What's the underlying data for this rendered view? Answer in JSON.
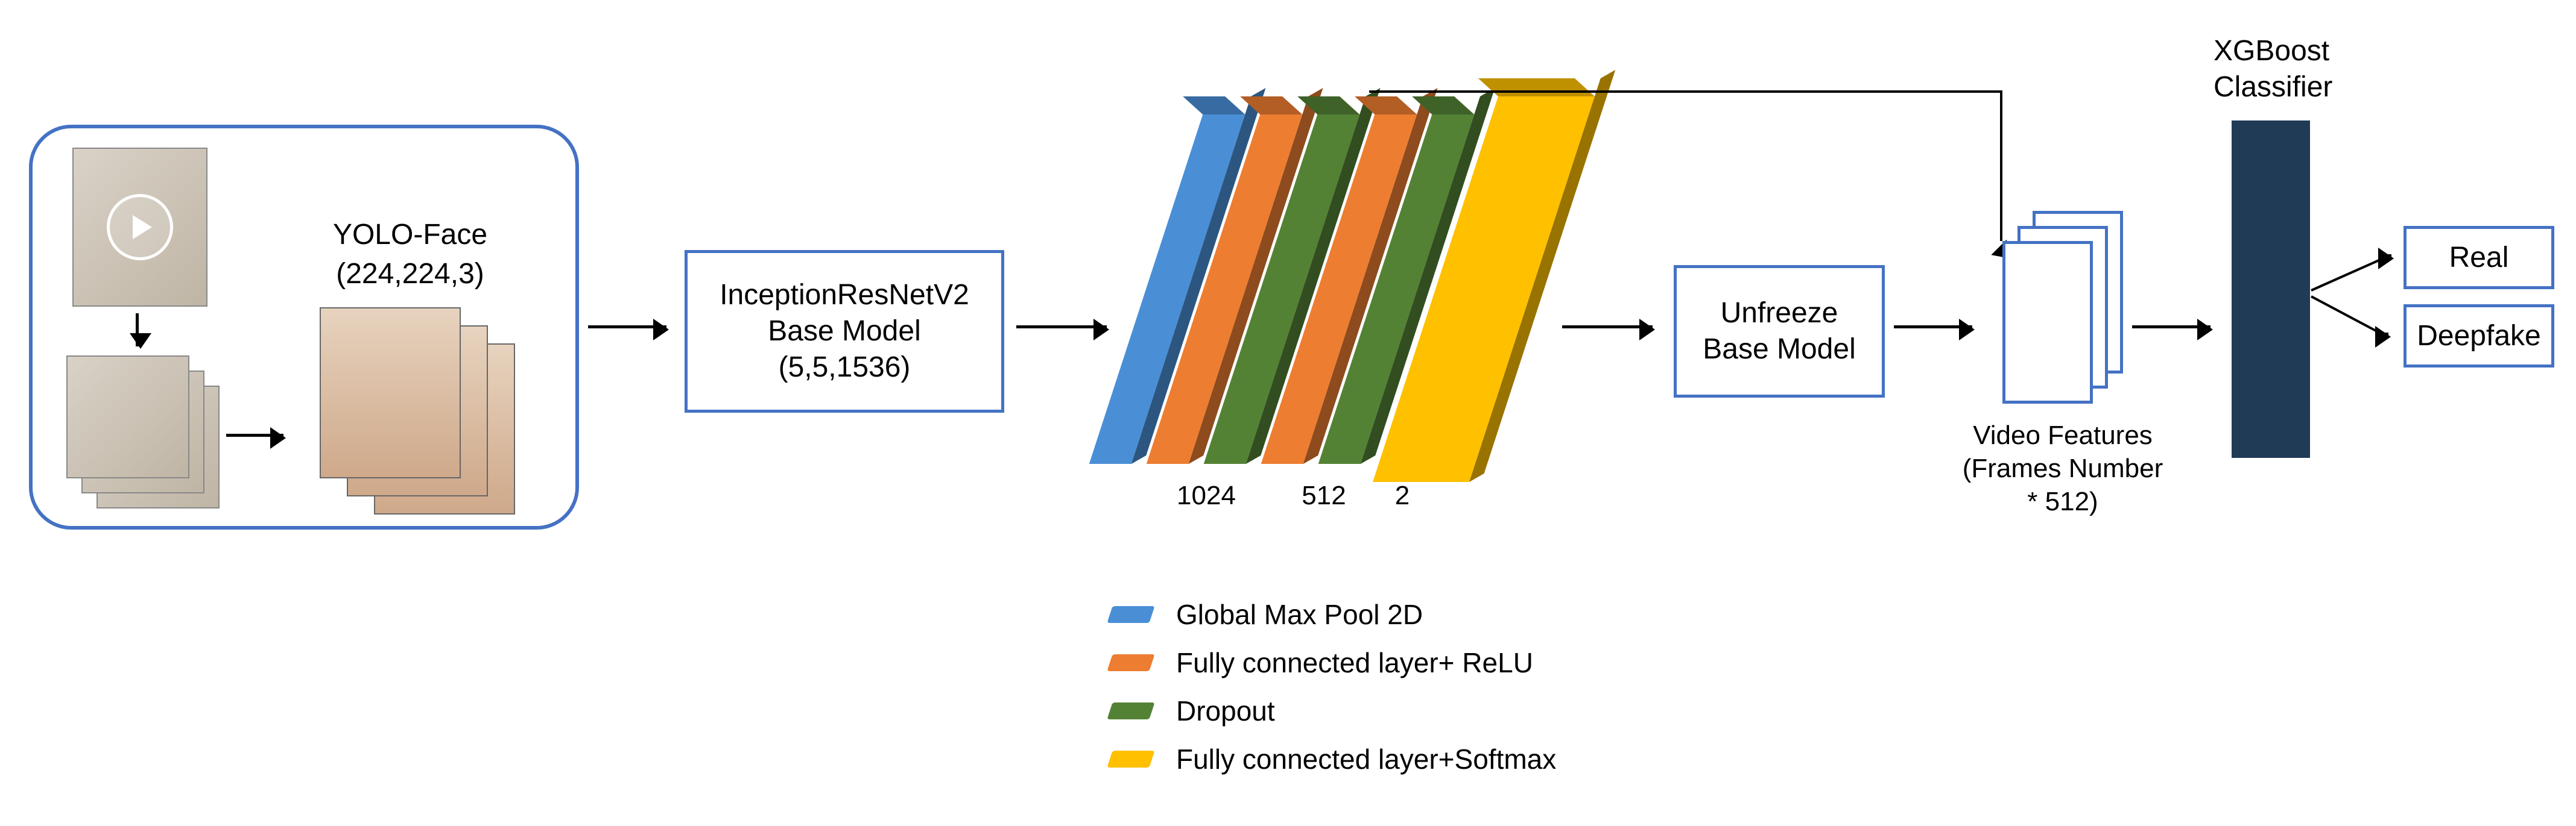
{
  "input_panel": {
    "yolo_title": "YOLO-Face",
    "yolo_shape": "(224,224,3)"
  },
  "base_model": {
    "name": "InceptionResNetV2",
    "subtitle": "Base Model",
    "shape": "(5,5,1536)"
  },
  "layers": {
    "dim1": "1024",
    "dim2": "512",
    "dim3": "2"
  },
  "legend": {
    "gmp": "Global Max Pool 2D",
    "fc_relu": "Fully connected layer+ ReLU",
    "dropout": "Dropout",
    "fc_softmax": "Fully connected layer+Softmax"
  },
  "unfreeze": {
    "line1": "Unfreeze",
    "line2": "Base Model"
  },
  "features": {
    "line1": "Video Features",
    "line2": "(Frames Number",
    "line3": "* 512)"
  },
  "classifier": {
    "title1": "XGBoost",
    "title2": "Classifier"
  },
  "outputs": {
    "real": "Real",
    "deepfake": "Deepfake"
  }
}
